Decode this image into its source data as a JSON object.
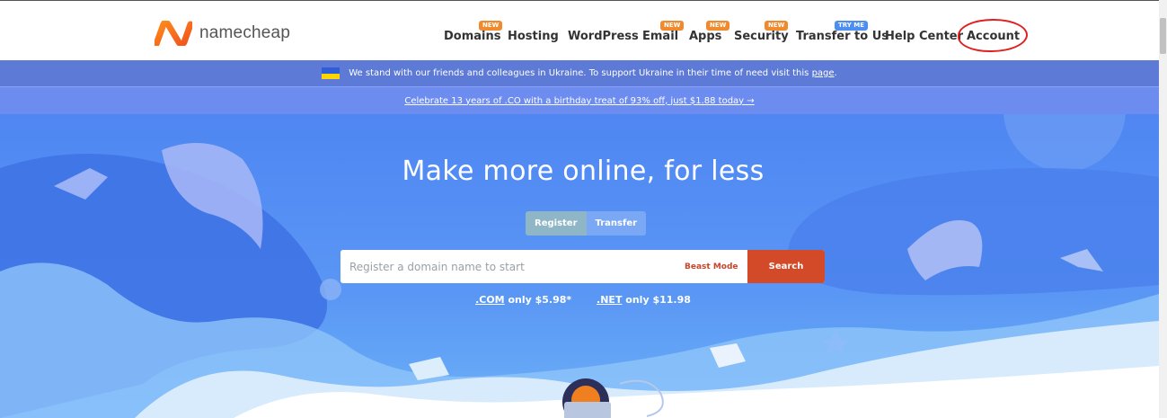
{
  "brand": {
    "name": "namecheap"
  },
  "nav": {
    "items": [
      {
        "label": "Domains",
        "badge": "NEW"
      },
      {
        "label": "Hosting"
      },
      {
        "label": "WordPress"
      },
      {
        "label": "Email",
        "badge": "NEW"
      },
      {
        "label": "Apps",
        "badge": "NEW"
      },
      {
        "label": "Security",
        "badge": "NEW"
      },
      {
        "label": "Transfer to Us",
        "badge": "TRY ME"
      },
      {
        "label": "Help Center"
      },
      {
        "label": "Account"
      }
    ]
  },
  "ukraine_banner": {
    "text": "We stand with our friends and colleagues in Ukraine. To support Ukraine in their time of need visit this",
    "link": "page",
    "suffix": "."
  },
  "promo_banner": {
    "text": "Celebrate 13 years of .CO with a birthday treat of 93% off, just $1.88 today →"
  },
  "hero": {
    "title": "Make more online, for less",
    "tabs": [
      "Register",
      "Transfer"
    ],
    "search": {
      "placeholder": "Register a domain name to start",
      "beast_mode": "Beast Mode",
      "button": "Search"
    },
    "prices": [
      {
        "tld": ".COM",
        "text": "only $5.98*"
      },
      {
        "tld": ".NET",
        "text": "only $11.98"
      }
    ]
  },
  "colors": {
    "accent": "#d24a27",
    "banner": "#5c7ad6",
    "promo": "#6d8cf0",
    "annotation": "#e02020"
  }
}
